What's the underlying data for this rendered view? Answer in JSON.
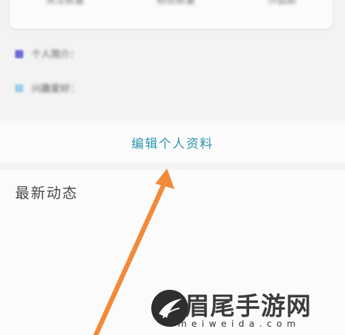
{
  "stats": {
    "items": [
      {
        "label": "关注数量"
      },
      {
        "label": "粉丝数量"
      },
      {
        "label": "作品数"
      }
    ]
  },
  "info": {
    "items": [
      {
        "label": "个人简介：",
        "icon": "person-icon",
        "color": "#6b6bd8"
      },
      {
        "label": "兴趣爱好：",
        "icon": "tag-icon",
        "color": "#9ad0ea"
      }
    ]
  },
  "profile": {
    "edit_label": "编辑个人资料",
    "accent": "#2b96ad"
  },
  "activity": {
    "title": "最新动态"
  },
  "annotation": {
    "arrow_color": "#f28a3a"
  },
  "watermark": {
    "site_name": "眉尾手游网",
    "url": "meiweida.com"
  }
}
